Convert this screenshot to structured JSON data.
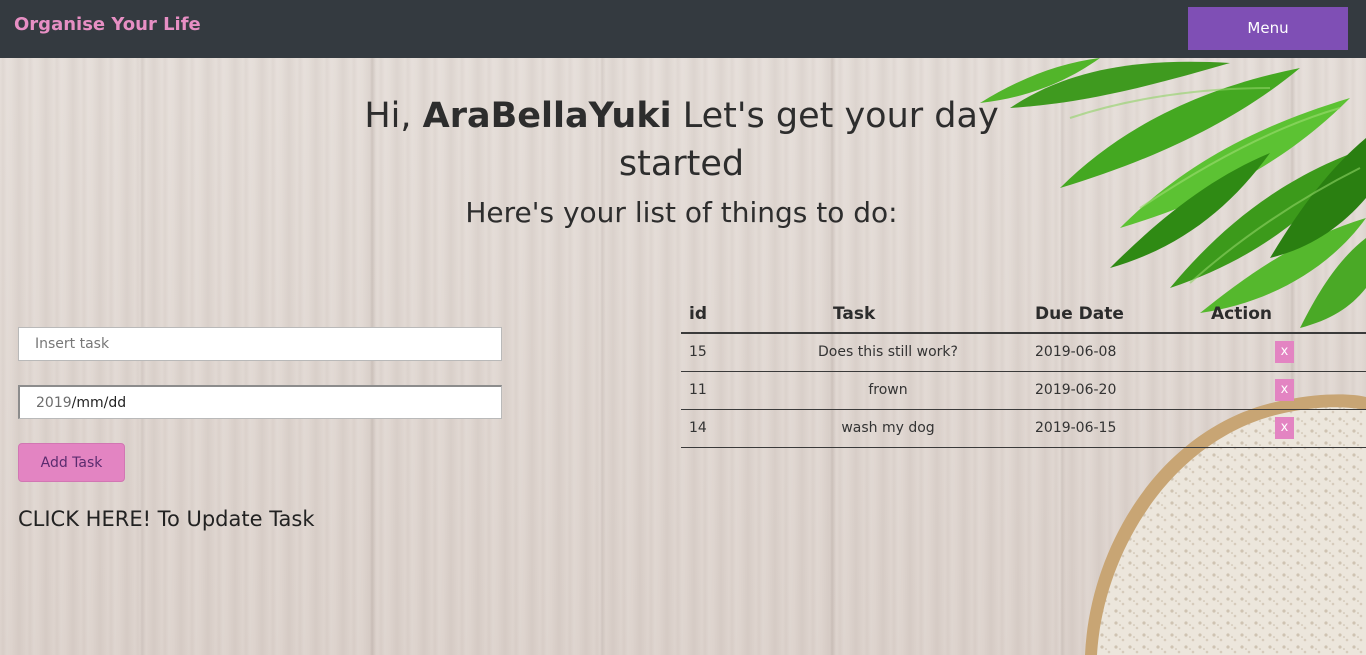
{
  "navbar": {
    "brand": "Organise Your Life",
    "menu_label": "Menu"
  },
  "header": {
    "greeting_prefix": "Hi, ",
    "username": "AraBellaYuki",
    "greeting_suffix": " Let's get your day started",
    "subheading": "Here's your list of things to do:"
  },
  "form": {
    "task_placeholder": "Insert task",
    "date_year": "2019",
    "date_rest": "/mm/dd",
    "add_label": "Add Task",
    "update_link": "CLICK HERE! To Update Task"
  },
  "table": {
    "headers": {
      "id": "id",
      "task": "Task",
      "due": "Due Date",
      "action": "Action"
    },
    "rows": [
      {
        "id": "15",
        "task": "Does this still work?",
        "due": "2019-06-08",
        "action": "x"
      },
      {
        "id": "11",
        "task": "frown",
        "due": "2019-06-20",
        "action": "x"
      },
      {
        "id": "14",
        "task": "wash my dog",
        "due": "2019-06-15",
        "action": "x"
      }
    ]
  },
  "colors": {
    "navbar": "#343a40",
    "brand": "#e78fc4",
    "menu_button": "#7f4fb5",
    "pink_button": "#e384c2"
  },
  "decor": {
    "top_right": "leaves-image",
    "bottom_right": "bread-image"
  }
}
